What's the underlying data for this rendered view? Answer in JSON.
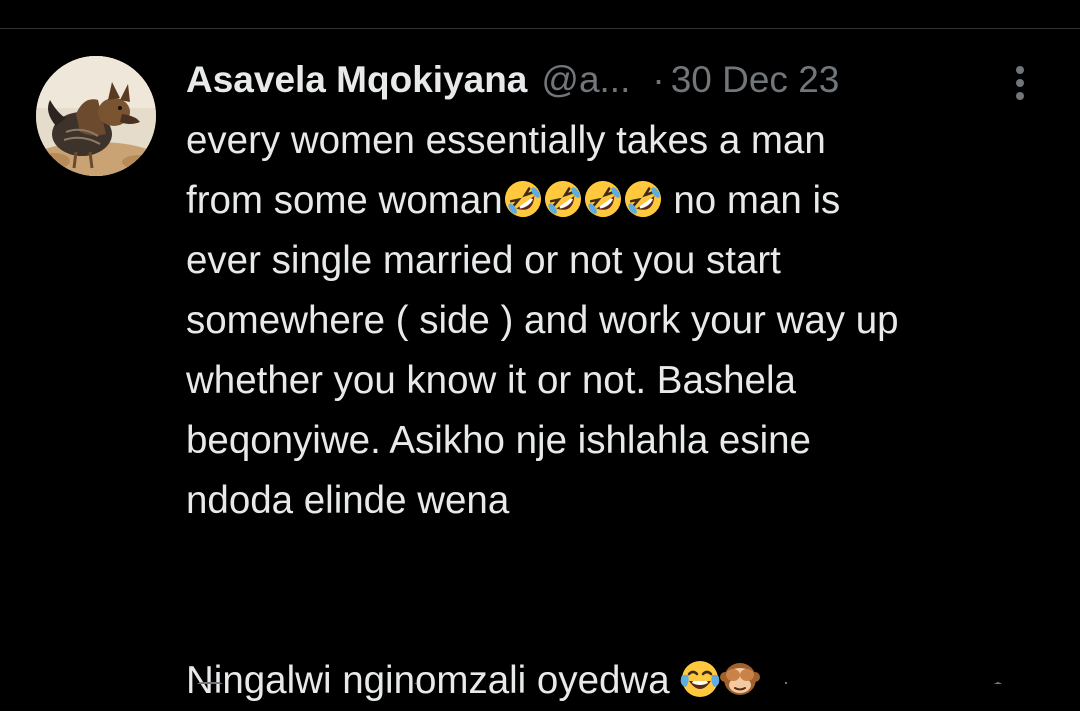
{
  "tweet": {
    "author": {
      "display_name": "Asavela Mqokiyana",
      "handle": "@a...",
      "avatar_icon": "rooster-dog-avatar"
    },
    "separator": "·",
    "date": "30 Dec 23",
    "more_icon": "vertical-ellipsis-icon",
    "text": {
      "line1": "every women essentially takes a man",
      "line2_start": "from some woman",
      "line2_emojis": [
        "rolling-on-floor-laughing",
        "rolling-on-floor-laughing",
        "rolling-on-floor-laughing",
        "rolling-on-floor-laughing"
      ],
      "line2_end": " no man is",
      "line3": "ever single married or not you start",
      "line4": "somewhere ( side ) and work your way up",
      "line5": "whether you know it or not. Bashela",
      "line6": "beqonyiwe. Asikho nje ishlahla esine",
      "line7": "ndoda elinde wena",
      "line8": "Ningalwi nginomzali oyedwa ",
      "line8_emojis": [
        "face-with-tears-of-joy",
        "see-no-evil-monkey"
      ]
    }
  },
  "colors": {
    "background": "#000000",
    "text_primary": "#e7e9ea",
    "text_secondary": "#71767b",
    "divider": "#2f3336",
    "emoji_yellow": "#ffc83d",
    "monkey_brown": "#a0612c"
  }
}
